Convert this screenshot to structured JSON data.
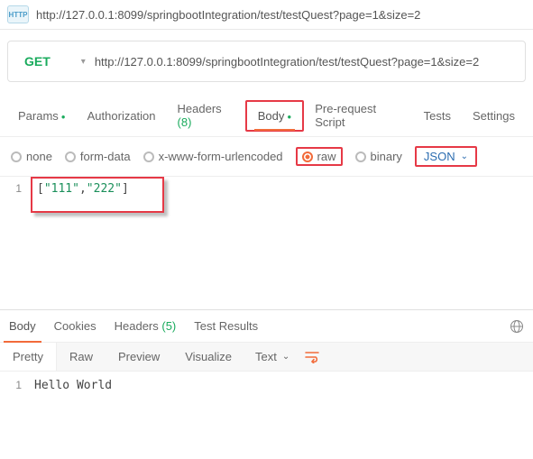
{
  "top_url": "http://127.0.0.1:8099/springbootIntegration/test/testQuest?page=1&size=2",
  "request": {
    "method": "GET",
    "url": "http://127.0.0.1:8099/springbootIntegration/test/testQuest?page=1&size=2"
  },
  "req_tabs": {
    "params": "Params",
    "auth": "Authorization",
    "headers": "Headers",
    "headers_count": "(8)",
    "body": "Body",
    "prereq": "Pre-request Script",
    "tests": "Tests",
    "settings": "Settings"
  },
  "body_types": {
    "none": "none",
    "formdata": "form-data",
    "urlenc": "x-www-form-urlencoded",
    "raw": "raw",
    "binary": "binary",
    "format": "JSON"
  },
  "body_code": {
    "line_no": "1",
    "open": "[",
    "s1": "\"111\"",
    "comma": ",",
    "s2": "\"222\"",
    "close": "]"
  },
  "resp_tabs": {
    "body": "Body",
    "cookies": "Cookies",
    "headers": "Headers",
    "headers_count": "(5)",
    "tests": "Test Results"
  },
  "view": {
    "pretty": "Pretty",
    "raw": "Raw",
    "preview": "Preview",
    "visualize": "Visualize",
    "text": "Text"
  },
  "response": {
    "line_no": "1",
    "text": "Hello World"
  }
}
